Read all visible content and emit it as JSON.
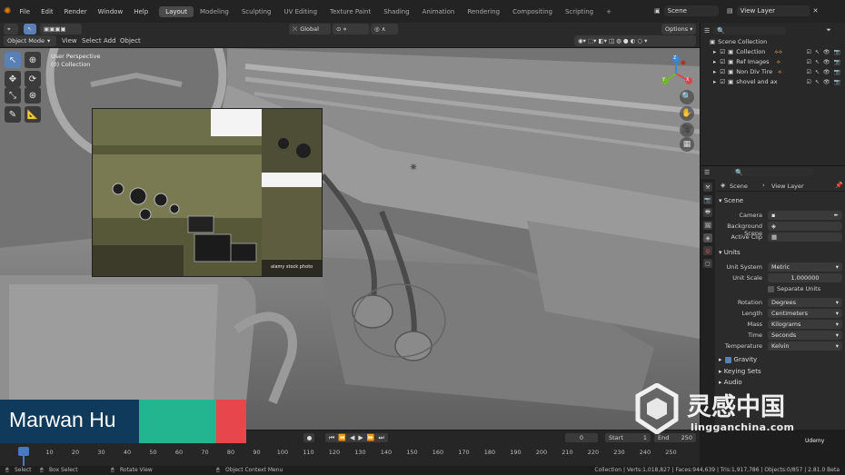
{
  "topbar": {
    "menus": [
      "File",
      "Edit",
      "Render",
      "Window",
      "Help"
    ],
    "workspaces": [
      {
        "label": "Layout",
        "active": true
      },
      {
        "label": "Modeling",
        "active": false
      },
      {
        "label": "Sculpting",
        "active": false
      },
      {
        "label": "UV Editing",
        "active": false
      },
      {
        "label": "Texture Paint",
        "active": false
      },
      {
        "label": "Shading",
        "active": false
      },
      {
        "label": "Animation",
        "active": false
      },
      {
        "label": "Rendering",
        "active": false
      },
      {
        "label": "Compositing",
        "active": false
      },
      {
        "label": "Scripting",
        "active": false
      }
    ],
    "add_workspace": "+",
    "scene": "Scene",
    "view_layer": "View Layer"
  },
  "viewport_header": {
    "mode": "Object Mode",
    "menus": [
      "View",
      "Select",
      "Add",
      "Object"
    ],
    "orientation": "Global",
    "options": "Options"
  },
  "viewport": {
    "perspective": "User Perspective",
    "collection": "(0) Collection",
    "ref_caption": "alamy stock photo",
    "gizmo": {
      "x": "X",
      "y": "Y",
      "z": "Z"
    }
  },
  "outliner": {
    "root": "Scene Collection",
    "items": [
      {
        "label": "Collection"
      },
      {
        "label": "Ref Images"
      },
      {
        "label": "Non Div Tire"
      },
      {
        "label": "shovel and ax"
      }
    ]
  },
  "properties": {
    "scene_name": "Scene",
    "view_layer": "View Layer",
    "section_scene": "Scene",
    "camera_label": "Camera",
    "bg_scene_label": "Background Scene",
    "active_clip_label": "Active Clip",
    "section_units": "Units",
    "unit_system_label": "Unit System",
    "unit_system": "Metric",
    "unit_scale_label": "Unit Scale",
    "unit_scale": "1.000000",
    "separate_units": "Separate Units",
    "rotation_label": "Rotation",
    "rotation": "Degrees",
    "length_label": "Length",
    "length": "Centimeters",
    "mass_label": "Mass",
    "mass": "Kilograms",
    "time_label": "Time",
    "time": "Seconds",
    "temperature_label": "Temperature",
    "temperature": "Kelvin",
    "gravity": "Gravity",
    "keying_sets": "Keying Sets",
    "audio": "Audio"
  },
  "timeline": {
    "current_frame": "0",
    "start_label": "Start",
    "start": "1",
    "end_label": "End",
    "end": "250",
    "ticks": [
      "0",
      "10",
      "20",
      "30",
      "40",
      "50",
      "60",
      "70",
      "80",
      "90",
      "100",
      "110",
      "120",
      "130",
      "140",
      "150",
      "160",
      "170",
      "180",
      "190",
      "200",
      "210",
      "220",
      "230",
      "240",
      "250"
    ]
  },
  "statusbar": {
    "select": "Select",
    "box_select": "Box Select",
    "rotate_view": "Rotate View",
    "context_menu": "Object Context Menu",
    "stats": "Collection | Verts:1,018,827 | Faces:944,639 | Tris:1,917,786 | Objects:0/857 | 2.81.0 Beta"
  },
  "lower_third": {
    "name": "Marwan Hu",
    "color_a": "#23b58f",
    "color_b": "#e6464c",
    "bg": "#0f3a5c"
  },
  "watermark": {
    "cn": "灵感中国",
    "domain": "lingganchina.com",
    "udemy": "Udemy"
  }
}
